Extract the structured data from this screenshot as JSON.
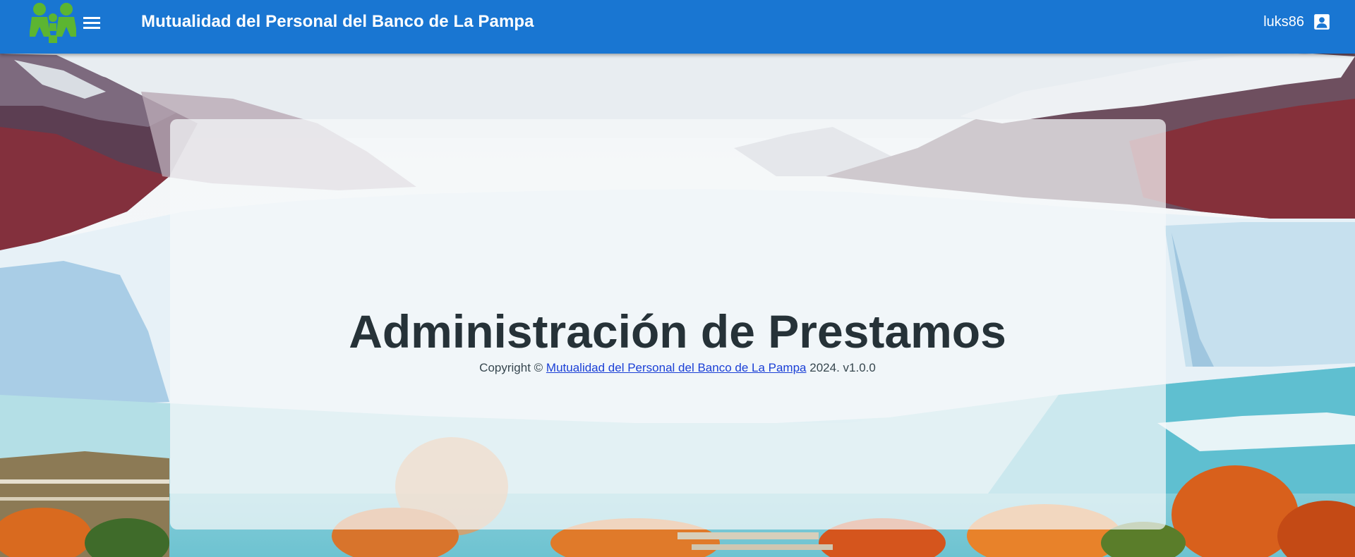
{
  "header": {
    "title": "Mutualidad del Personal del Banco de La Pampa",
    "username": "luks86",
    "logo_icon": "family-logo-icon",
    "menu_icon": "hamburger-menu-icon",
    "account_icon": "account-box-icon",
    "bar_color": "#1976d2"
  },
  "main": {
    "heading": "Administración de Prestamos",
    "copyright": {
      "prefix": "Copyright ©",
      "link_text": "Mutualidad del Personal del Banco de La Pampa",
      "suffix": "2024. v1.0.0"
    }
  },
  "colors": {
    "logo_green": "#5cb531",
    "link_blue": "#1a3fd6",
    "heading_text": "#263238"
  }
}
